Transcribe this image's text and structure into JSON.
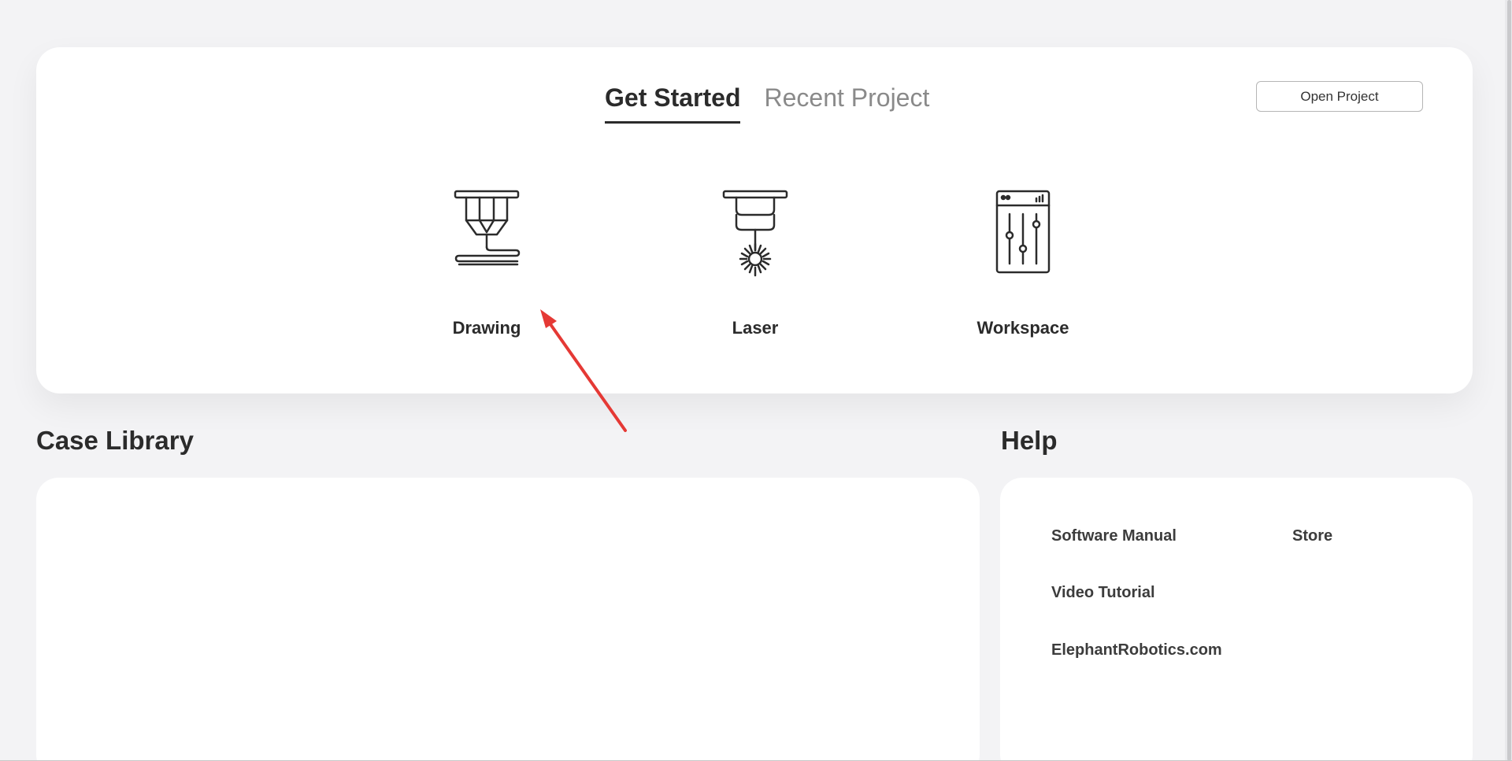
{
  "tabs": {
    "get_started": "Get Started",
    "recent_project": "Recent Project"
  },
  "open_project_label": "Open Project",
  "modes": [
    {
      "label": "Drawing",
      "icon": "pen-plotter-icon"
    },
    {
      "label": "Laser",
      "icon": "laser-head-icon"
    },
    {
      "label": "Workspace",
      "icon": "sliders-panel-icon"
    }
  ],
  "case_library": {
    "title": "Case Library"
  },
  "help": {
    "title": "Help",
    "links": {
      "software_manual": "Software Manual",
      "store": "Store",
      "video_tutorial": "Video Tutorial",
      "website": "ElephantRobotics.com"
    }
  },
  "colors": {
    "background": "#f3f3f5",
    "card": "#ffffff",
    "text": "#2b2b2b",
    "muted_text": "#8a8a8a",
    "annotation_arrow": "#e53935"
  }
}
